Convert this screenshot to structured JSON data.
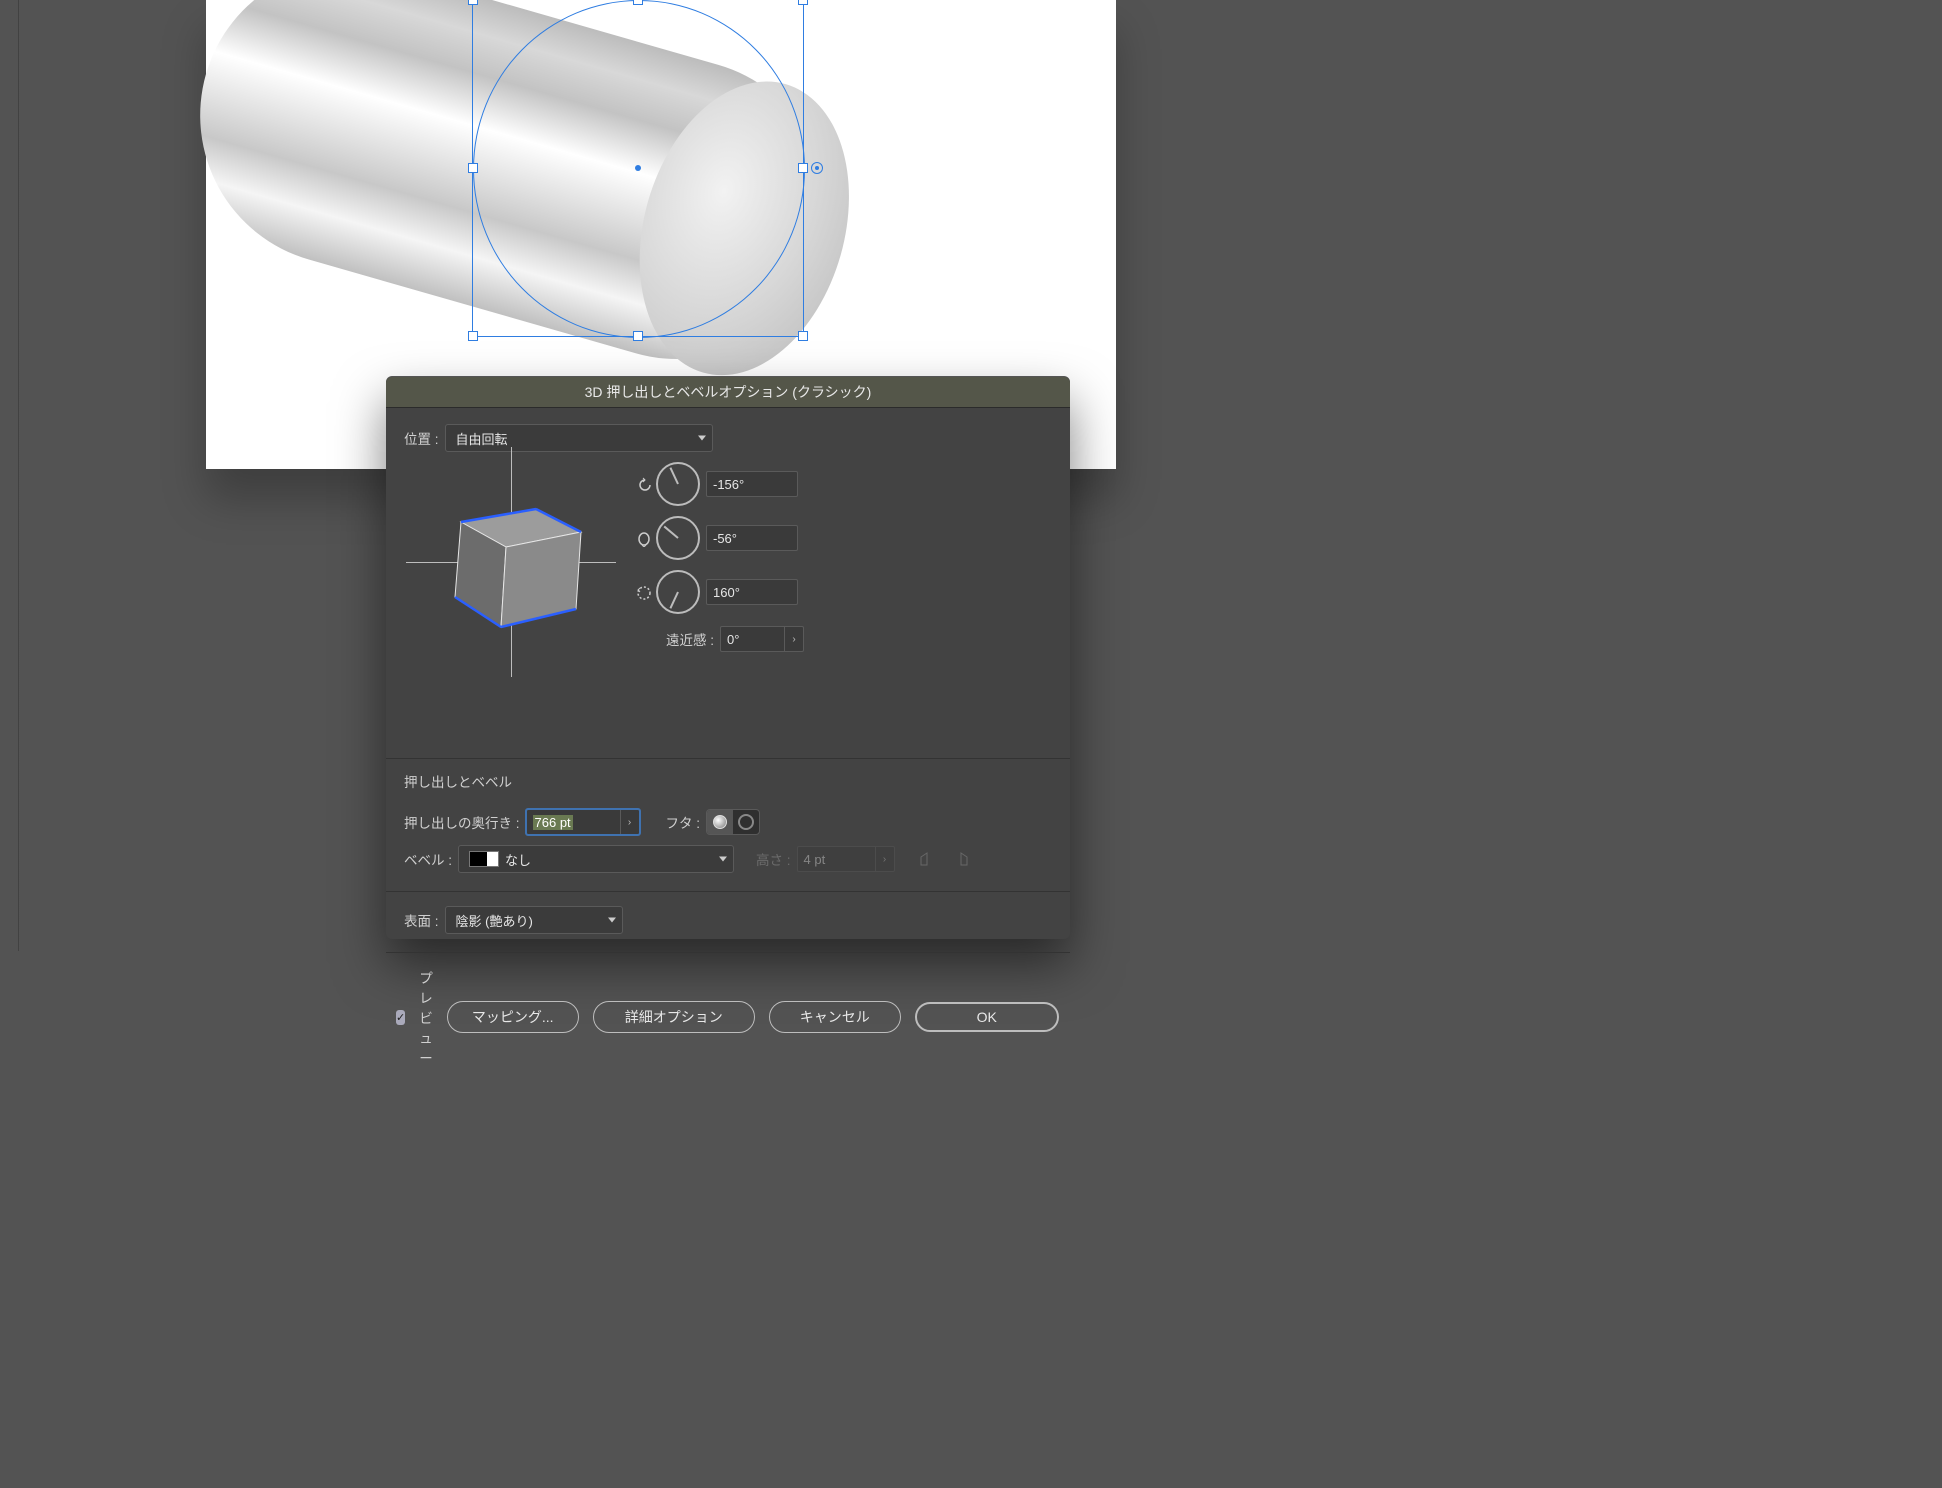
{
  "dialog": {
    "title": "3D 押し出しとベベルオプション (クラシック)",
    "position_label": "位置 :",
    "position_value": "自由回転",
    "rotation_x": "-156°",
    "rotation_y": "-56°",
    "rotation_z": "160°",
    "perspective_label": "遠近感 :",
    "perspective_value": "0°",
    "extrude_section": "押し出しとベベル",
    "depth_label": "押し出しの奥行き :",
    "depth_value": "766 pt",
    "cap_label": "フタ :",
    "bevel_label": "ベベル :",
    "bevel_value": "なし",
    "height_label": "高さ :",
    "height_value": "4 pt",
    "surface_label": "表面 :",
    "surface_value": "陰影 (艶あり)",
    "preview_label": "プレビュー",
    "mapping_btn": "マッピング...",
    "more_options_btn": "詳細オプション",
    "cancel_btn": "キャンセル",
    "ok_btn": "OK"
  }
}
